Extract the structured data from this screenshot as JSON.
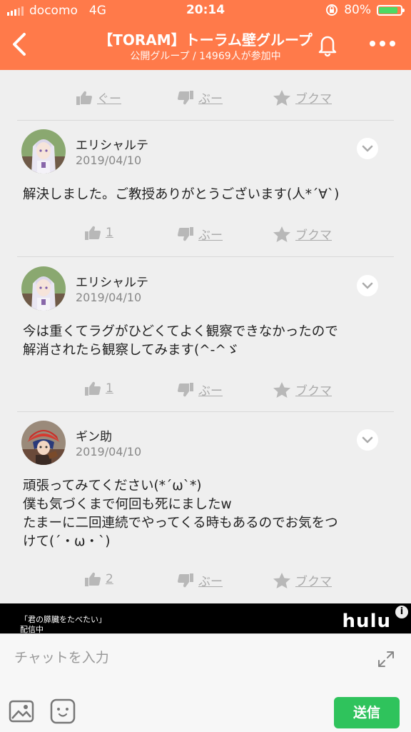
{
  "status": {
    "carrier": "docomo",
    "network": "4G",
    "time": "20:14",
    "battery": "80%"
  },
  "header": {
    "title": "【TORAM】トーラム壁グループ",
    "subtitle": "公開グループ / 14969人が参加中"
  },
  "action_labels": {
    "like": "ぐー",
    "dislike": "ぶー",
    "bookmark": "ブクマ"
  },
  "posts": [
    {
      "like": "ぐー"
    },
    {
      "author": "エリシャルテ",
      "date": "2019/04/10",
      "body": "解決しました。ご教授ありがとうございます(人*´∀`)",
      "likes": "1"
    },
    {
      "author": "エリシャルテ",
      "date": "2019/04/10",
      "body": "今は重くてラグがひどくてよく観察できなかったので\n解消されたら観察してみます(^-^ゞ",
      "likes": "1"
    },
    {
      "author": "ギン助",
      "date": "2019/04/10",
      "body": "頑張ってみてください(*´ω`*)\n僕も気づくまで何回も死にましたw\nたまーに二回連続でやってくる時もあるのでお気をつ\nけて(´・ω・`)",
      "likes": "2"
    }
  ],
  "ad": {
    "text1": "「君の膵臓をたべたい」",
    "text2": "配信中",
    "brand": "hulu",
    "info": "i"
  },
  "input": {
    "placeholder": "チャットを入力",
    "send": "送信"
  },
  "colors": {
    "accent": "#ff7a4a",
    "send": "#2fc35c",
    "battery": "#4cd964"
  }
}
